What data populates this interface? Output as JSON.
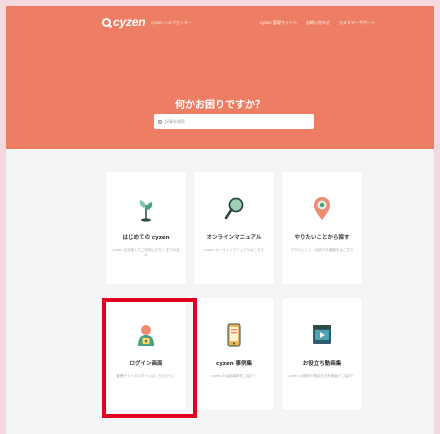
{
  "header": {
    "brand": "cyzen",
    "subtitle": "cyzen ヘルプセンター",
    "nav": [
      "cyzen 管理サイトへ",
      "お問い合わせ",
      "カスタマーサポート"
    ]
  },
  "hero": {
    "title": "何かお困りですか？",
    "search_placeholder": "記事を検索"
  },
  "cards": [
    {
      "title": "はじめての cyzen",
      "desc": "cyzen を活用してご利用いただくまでの流れ",
      "icon": "sprout-icon"
    },
    {
      "title": "オンラインマニュアル",
      "desc": "cyzen オンラインマニュアルはこちら",
      "icon": "magnifier-icon"
    },
    {
      "title": "やりたいことから探す",
      "desc": "やりたいこと・目的から機能をはこちら",
      "icon": "map-pin-icon"
    },
    {
      "title": "ログイン画面",
      "desc": "管理サイトのログインはこちらから！",
      "icon": "login-user-icon"
    },
    {
      "title": "cyzen 事例集",
      "desc": "cyzen の活用事例をご紹介！",
      "icon": "smartphone-icon"
    },
    {
      "title": "お役立ち動画集",
      "desc": "cyzen の操作や設定方法を動画でご紹介！",
      "icon": "video-icon"
    }
  ],
  "colors": {
    "hero": "#ee7e63",
    "highlight": "#e0001f",
    "outer_background": "#f5d7df"
  }
}
